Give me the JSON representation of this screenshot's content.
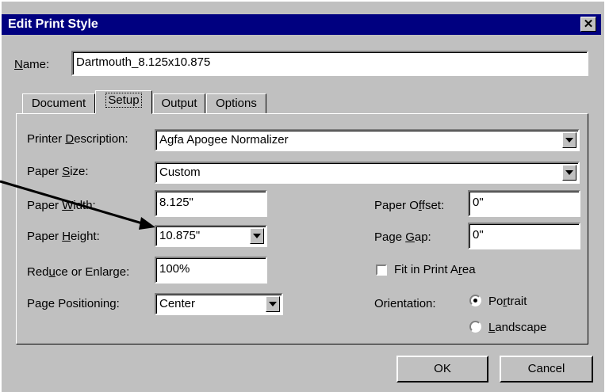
{
  "window": {
    "title": "Edit Print Style",
    "close_glyph": "✕"
  },
  "name": {
    "label_pre": "",
    "label_u": "N",
    "label_post": "ame:",
    "value": "Dartmouth_8.125x10.875"
  },
  "tabs": [
    "Document",
    "Setup",
    "Output",
    "Options"
  ],
  "setup": {
    "printer_desc": {
      "label_pre": "Printer ",
      "label_u": "D",
      "label_post": "escription:",
      "value": "Agfa Apogee Normalizer"
    },
    "paper_size": {
      "label_pre": "Paper ",
      "label_u": "S",
      "label_post": "ize:",
      "value": "Custom"
    },
    "paper_width": {
      "label_pre": "Paper ",
      "label_u": "W",
      "label_post": "idth:",
      "value": "8.125\""
    },
    "paper_height": {
      "label_pre": "Paper ",
      "label_u": "H",
      "label_post": "eight:",
      "value": "10.875\""
    },
    "reduce": {
      "label_pre": "Red",
      "label_u": "u",
      "label_post": "ce or Enlarge:",
      "value": "100%"
    },
    "positioning": {
      "label_pre": "Pa",
      "label_u": "g",
      "label_post": "e Positioning:",
      "value": "Center"
    },
    "paper_offset": {
      "label_pre": "Paper O",
      "label_u": "f",
      "label_post": "fset:",
      "value": "0\""
    },
    "page_gap": {
      "label_pre": "Page ",
      "label_u": "G",
      "label_post": "ap:",
      "value": "0\""
    },
    "fit_print_area": {
      "label_pre": "Fit in Print A",
      "label_u": "r",
      "label_post": "ea",
      "checked": false
    },
    "orientation": {
      "label": "Orientation:",
      "portrait": {
        "label_pre": "Po",
        "label_u": "r",
        "label_post": "trait",
        "selected": true
      },
      "landscape": {
        "label_pre": "",
        "label_u": "L",
        "label_post": "andscape",
        "selected": false
      }
    }
  },
  "buttons": {
    "ok": "OK",
    "cancel": "Cancel"
  }
}
